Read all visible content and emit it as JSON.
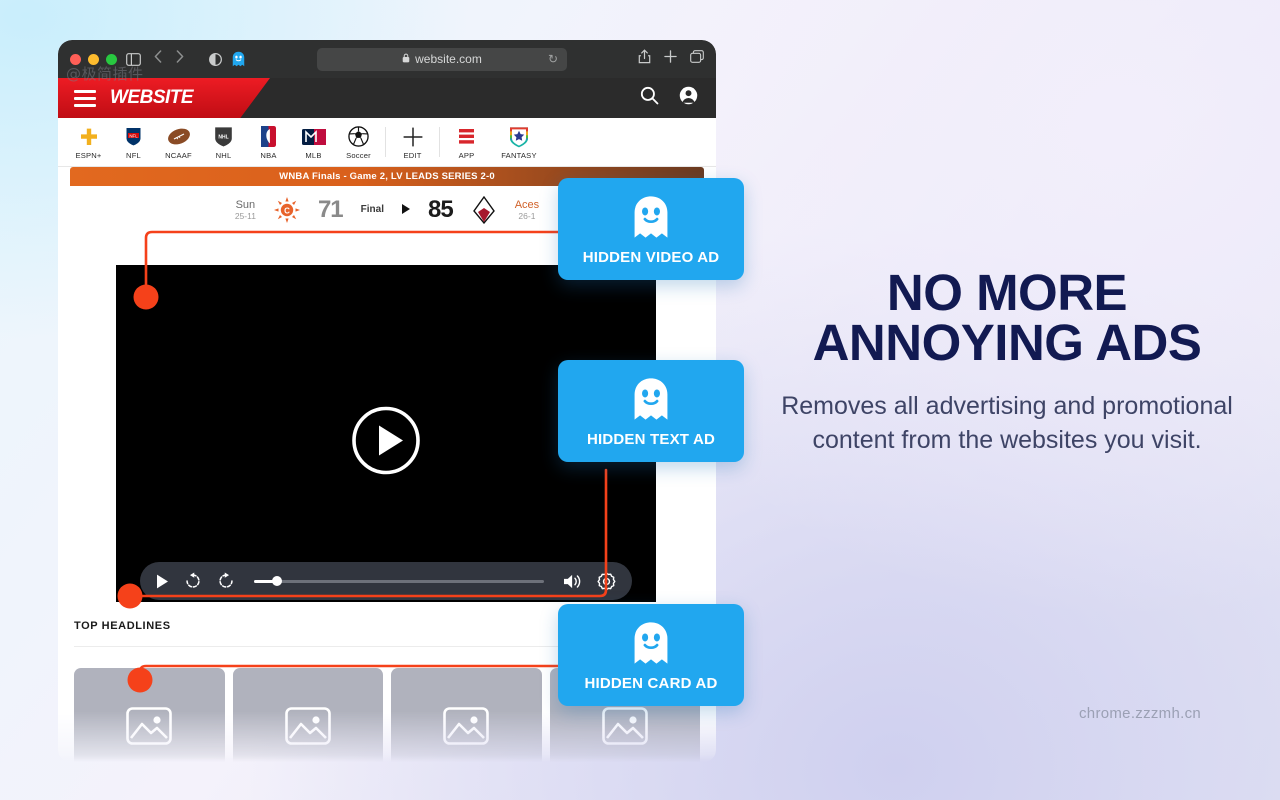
{
  "watermarks": {
    "top_left": "@极简插件",
    "bottom_right": "chrome.zzzmh.cn"
  },
  "browser": {
    "url": "website.com",
    "lock_icon": "lock-icon",
    "reload_icon": "reload-icon",
    "back_icon": "chevron-left-icon",
    "forward_icon": "chevron-right-icon",
    "sidebar_icon": "sidebar-icon",
    "reader_icon": "reader-mode-icon",
    "extension_icon": "ghostery-ghost-icon",
    "share_icon": "share-icon",
    "new_tab_icon": "plus-icon",
    "tabs_icon": "tab-overview-icon"
  },
  "site": {
    "brand": "WEBSITE",
    "menu_icon": "hamburger-menu-icon",
    "search_icon": "search-icon",
    "account_icon": "account-avatar-icon",
    "nav": [
      {
        "label": "ESPN+",
        "icon": "espn-plus-icon"
      },
      {
        "label": "NFL",
        "icon": "nfl-shield-icon"
      },
      {
        "label": "NCAAF",
        "icon": "football-icon"
      },
      {
        "label": "NHL",
        "icon": "nhl-shield-icon"
      },
      {
        "label": "NBA",
        "icon": "nba-logo-icon"
      },
      {
        "label": "MLB",
        "icon": "mlb-logo-icon"
      },
      {
        "label": "Soccer",
        "icon": "soccer-ball-icon"
      },
      {
        "label": "EDIT",
        "icon": "plus-icon"
      },
      {
        "label": "APP",
        "icon": "espn-app-icon"
      },
      {
        "label": "FANTASY",
        "icon": "fantasy-star-icon"
      }
    ]
  },
  "scoreboard": {
    "banner": "WNBA Finals - Game 2, LV LEADS SERIES 2-0",
    "away": {
      "name": "Sun",
      "record": "25-11",
      "score": "71",
      "logo": "connecticut-sun-logo"
    },
    "status": "Final",
    "home": {
      "name": "Aces",
      "record": "26-1",
      "score": "85",
      "logo": "las-vegas-aces-logo"
    },
    "possession_icon": "caret-right-icon"
  },
  "video": {
    "play_icon": "play-circle-icon",
    "controls": {
      "play": "play-icon",
      "rewind": "rewind-10-icon",
      "forward": "forward-10-icon",
      "volume": "volume-icon",
      "settings": "gear-icon",
      "progress_percent": 8
    }
  },
  "headlines": {
    "title": "TOP HEADLINES",
    "cards": [
      {
        "icon": "image-placeholder-icon"
      },
      {
        "icon": "image-placeholder-icon"
      },
      {
        "icon": "image-placeholder-icon"
      },
      {
        "icon": "image-placeholder-icon"
      }
    ]
  },
  "badges": [
    {
      "label": "HIDDEN VIDEO AD",
      "icon": "ghost-icon"
    },
    {
      "label": "HIDDEN TEXT AD",
      "icon": "ghost-icon"
    },
    {
      "label": "HIDDEN CARD AD",
      "icon": "ghost-icon"
    }
  ],
  "marketing": {
    "title_line1": "NO MORE",
    "title_line2": "ANNOYING ADS",
    "subtitle": "Removes all advertising and promotional content from the websites you visit."
  },
  "colors": {
    "badge_blue": "#21a7ef",
    "connector_red": "#f5411a",
    "brand_red": "#ed1c24",
    "title_navy": "#121a52",
    "subtitle_slate": "#3e4466"
  }
}
